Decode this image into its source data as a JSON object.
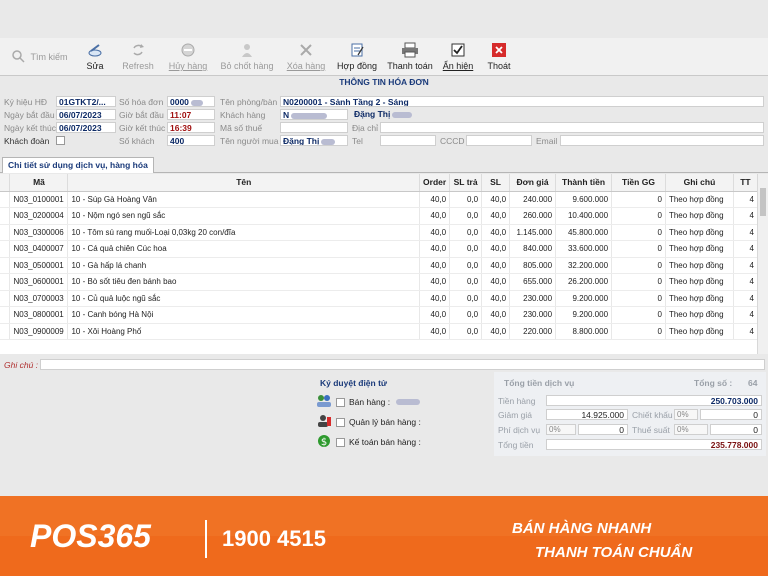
{
  "toolbar": {
    "search": "Tìm kiếm",
    "edit": "Sửa",
    "refresh": "Refresh",
    "cancel": "Hủy hàng",
    "unlock": "Bỏ chốt hàng",
    "delete": "Xóa hàng",
    "contract": "Hợp đồng",
    "pay": "Thanh toán",
    "show": "Ẩn hiện",
    "exit": "Thoát"
  },
  "invoice": {
    "title": "THÔNG TIN HÓA ĐƠN",
    "labels": {
      "symbol": "Ký hiệu HĐ",
      "start_date": "Ngày bắt đầu",
      "end_date": "Ngày kết thúc",
      "group": "Khách đoàn",
      "number": "Số hóa đơn",
      "start_time": "Giờ bắt đầu",
      "end_time": "Giờ kết thúc",
      "guests": "Số khách",
      "room": "Tên phòng/bàn",
      "customer": "Khách hàng",
      "tax": "Mã số thuế",
      "buyer": "Tên người mua",
      "address": "Địa chỉ",
      "phone": "Tel",
      "id": "CCCD",
      "email": "Email"
    },
    "values": {
      "symbol": "01GTKT2/...",
      "start_date": "06/07/2023",
      "end_date": "06/07/2023",
      "number": "0000",
      "start_time": "11:07",
      "end_time": "16:39",
      "guests": "400",
      "room": "N0200001 - Sảnh Tầng 2 - Sáng",
      "customer_code": "N",
      "customer_name": "Đặng Thị",
      "buyer": "Đặng Thị"
    }
  },
  "tab": "Chi tiết sử dụng dịch vụ, hàng hóa",
  "table": {
    "headers": [
      "Mã",
      "Tên",
      "Order",
      "SL trả",
      "SL",
      "Đơn giá",
      "Thành tiền",
      "Tiền GG",
      "Ghi chú",
      "TT"
    ],
    "rows": [
      [
        "N03_0100001",
        "10 - Súp Gà Hoàng Vân",
        "40,0",
        "0,0",
        "40,0",
        "240.000",
        "9.600.000",
        "0",
        "Theo hợp đồng",
        "4"
      ],
      [
        "N03_0200004",
        "10 - Nộm ngó sen ngũ sắc",
        "40,0",
        "0,0",
        "40,0",
        "260.000",
        "10.400.000",
        "0",
        "Theo hợp đồng",
        "4"
      ],
      [
        "N03_0300006",
        "10 - Tôm sú rang muối-Loại 0,03kg 20 con/đĩa",
        "40,0",
        "0,0",
        "40,0",
        "1.145.000",
        "45.800.000",
        "0",
        "Theo hợp đồng",
        "4"
      ],
      [
        "N03_0400007",
        "10 - Cá quả chiên Cúc hoa",
        "40,0",
        "0,0",
        "40,0",
        "840.000",
        "33.600.000",
        "0",
        "Theo hợp đồng",
        "4"
      ],
      [
        "N03_0500001",
        "10 - Gà hấp lá chanh",
        "40,0",
        "0,0",
        "40,0",
        "805.000",
        "32.200.000",
        "0",
        "Theo hợp đồng",
        "4"
      ],
      [
        "N03_0600001",
        "10 - Bò sốt tiêu đen bánh bao",
        "40,0",
        "0,0",
        "40,0",
        "655.000",
        "26.200.000",
        "0",
        "Theo hợp đồng",
        "4"
      ],
      [
        "N03_0700003",
        "10 - Củ quả luộc ngũ sắc",
        "40,0",
        "0,0",
        "40,0",
        "230.000",
        "9.200.000",
        "0",
        "Theo hợp đồng",
        "4"
      ],
      [
        "N03_0800001",
        "10 - Canh bóng Hà Nội",
        "40,0",
        "0,0",
        "40,0",
        "230.000",
        "9.200.000",
        "0",
        "Theo hợp đồng",
        "4"
      ],
      [
        "N03_0900009",
        "10 - Xôi Hoàng Phố",
        "40,0",
        "0,0",
        "40,0",
        "220.000",
        "8.800.000",
        "0",
        "Theo hợp đồng",
        "4"
      ]
    ]
  },
  "note_label": "Ghi chú :",
  "approve": {
    "title": "Ký duyệt điện tử",
    "sales": "Bán hàng :",
    "manager": "Quản lý bán hàng :",
    "accountant": "Kế toán bán hàng :"
  },
  "totals": {
    "title": "Tổng tiền dịch vụ",
    "count_label": "Tổng số :",
    "count": "64",
    "goods_label": "Tiền hàng",
    "goods": "250.703.000",
    "discount_label": "Giảm giá",
    "discount": "14.925.000",
    "rebate_label": "Chiết khấu",
    "rebate_pct": "0%",
    "rebate": "0",
    "service_label": "Phí dịch vụ",
    "service_pct": "0%",
    "service": "0",
    "tax_label": "Thuế suất",
    "tax_pct": "0%",
    "tax": "0",
    "total_label": "Tổng tiền",
    "total": "235.778.000"
  },
  "banner": {
    "logo": "POS365",
    "phone": "1900 4515",
    "slogan1": "BÁN HÀNG NHANH",
    "slogan2": "THANH TOÁN CHUẨN"
  }
}
